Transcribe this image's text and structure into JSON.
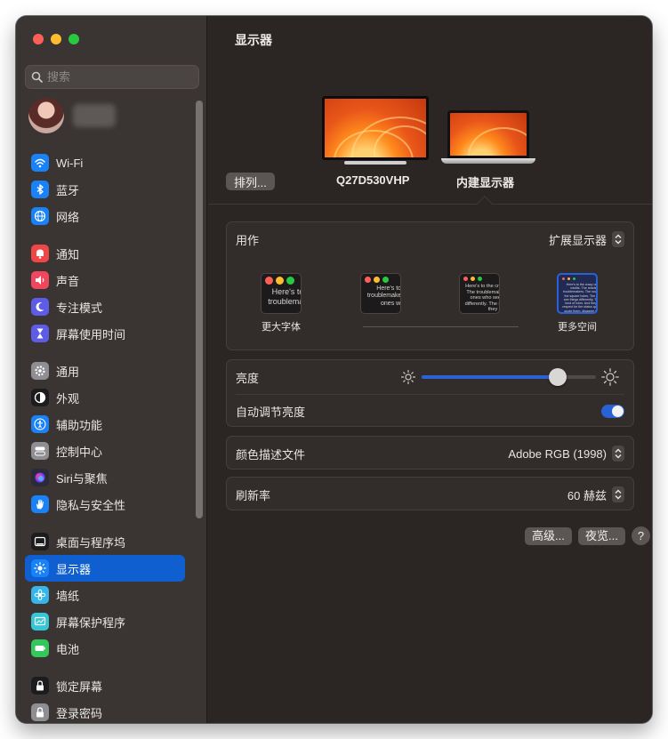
{
  "window": {
    "title": "显示器"
  },
  "search": {
    "placeholder": "搜索"
  },
  "sidebar": {
    "groups": [
      [
        {
          "label": "Wi-Fi",
          "icon": "wifi-icon",
          "color": "#1a82f7"
        },
        {
          "label": "蓝牙",
          "icon": "bluetooth-icon",
          "color": "#1a82f7"
        },
        {
          "label": "网络",
          "icon": "globe-icon",
          "color": "#1a82f7"
        }
      ],
      [
        {
          "label": "通知",
          "icon": "bell-icon",
          "color": "#f04646"
        },
        {
          "label": "声音",
          "icon": "speaker-icon",
          "color": "#f0465e"
        },
        {
          "label": "专注模式",
          "icon": "moon-icon",
          "color": "#5e5ce6"
        },
        {
          "label": "屏幕使用时间",
          "icon": "hourglass-icon",
          "color": "#5e5ce6"
        }
      ],
      [
        {
          "label": "通用",
          "icon": "gear-icon",
          "color": "#8e8e93"
        },
        {
          "label": "外观",
          "icon": "appearance-icon",
          "color": "#1c1c1e"
        },
        {
          "label": "辅助功能",
          "icon": "accessibility-icon",
          "color": "#1a82f7"
        },
        {
          "label": "控制中心",
          "icon": "control-center-icon",
          "color": "#8e8e93"
        },
        {
          "label": "Siri与聚焦",
          "icon": "siri-icon",
          "color": "#2a2a3a"
        },
        {
          "label": "隐私与安全性",
          "icon": "hand-icon",
          "color": "#1a82f7"
        }
      ],
      [
        {
          "label": "桌面与程序坞",
          "icon": "dock-icon",
          "color": "#1c1c1e"
        },
        {
          "label": "显示器",
          "icon": "display-brightness-icon",
          "color": "#1a82f7",
          "active": true
        },
        {
          "label": "墙纸",
          "icon": "wallpaper-icon",
          "color": "#35b6e8"
        },
        {
          "label": "屏幕保护程序",
          "icon": "screensaver-icon",
          "color": "#35c6d8"
        },
        {
          "label": "电池",
          "icon": "battery-icon",
          "color": "#34c759"
        }
      ],
      [
        {
          "label": "锁定屏幕",
          "icon": "lock-icon",
          "color": "#1c1c1e"
        },
        {
          "label": "登录密码",
          "icon": "padlock-icon",
          "color": "#8e8e93"
        }
      ]
    ]
  },
  "displays": {
    "arrange_label": "排列...",
    "external_name": "Q27D530VHP",
    "builtin_name": "内建显示器"
  },
  "use_as": {
    "label": "用作",
    "value": "扩展显示器",
    "resolution_options": [
      {
        "label": "更大字体",
        "sample": "Here's to the troublemakers.",
        "selected": false
      },
      {
        "label": "",
        "sample": "Here's to the troublemakers. The ones who",
        "selected": false
      },
      {
        "label": "",
        "sample": "Here's to the crazy ones. The troublemakers. The ones who see things differently. The rules. And they",
        "selected": false
      },
      {
        "label": "更多空间",
        "sample": "Here's to the crazy ones. The misfits. The rebels. The troublemakers. The round pegs in the square holes. The ones who see things differently. They're not fond of rules. And they have no respect for the status quo. You can quote them, disagree with them, glorify or vilify them. About the only thing you can't do is ignore them. Because they change things.",
        "selected": true
      }
    ]
  },
  "brightness": {
    "label": "亮度",
    "level": 0.78
  },
  "auto_brightness": {
    "label": "自动调节亮度",
    "enabled": true
  },
  "color_profile": {
    "label": "颜色描述文件",
    "value": "Adobe RGB (1998)"
  },
  "refresh_rate": {
    "label": "刷新率",
    "value": "60 赫兹"
  },
  "buttons": {
    "advanced": "高级...",
    "night_shift": "夜览...",
    "help": "?"
  }
}
